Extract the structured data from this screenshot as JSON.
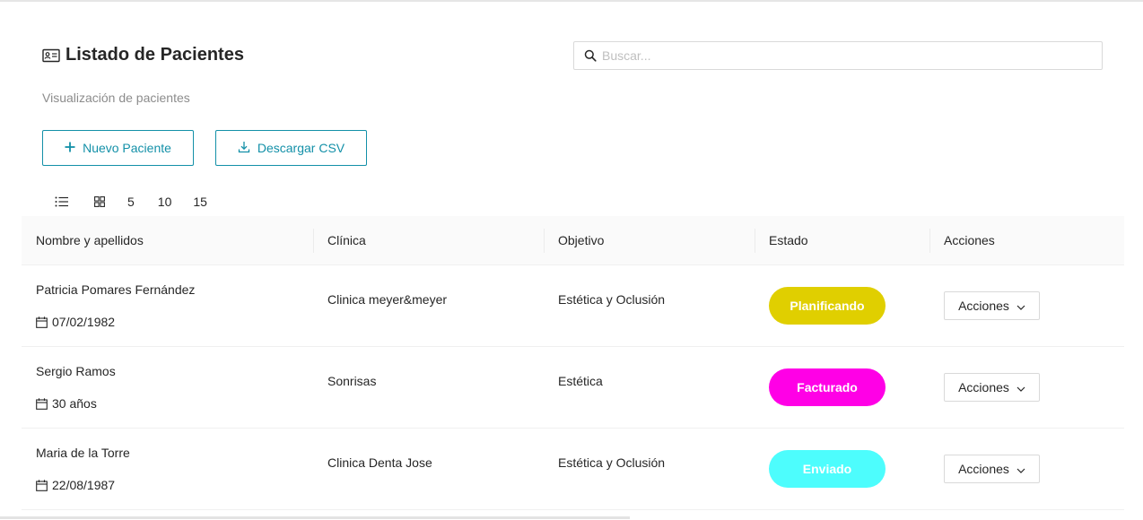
{
  "header": {
    "title": "Listado de Pacientes",
    "subtitle": "Visualización de pacientes",
    "title_icon": "id-card-icon"
  },
  "search": {
    "placeholder": "Buscar...",
    "value": "",
    "icon": "search-icon"
  },
  "toolbar": {
    "new_label": "Nuevo Paciente",
    "csv_label": "Descargar CSV"
  },
  "view_options": {
    "list_icon": "list-view-icon",
    "grid_icon": "grid-view-icon",
    "page_sizes": [
      "5",
      "10",
      "15"
    ]
  },
  "table": {
    "columns": [
      "Nombre y apellidos",
      "Clínica",
      "Objetivo",
      "Estado",
      "Acciones"
    ],
    "rows": [
      {
        "name": "Patricia Pomares Fernández",
        "date": "07/02/1982",
        "clinic": "Clinica meyer&meyer",
        "objective": "Estética y Oclusión",
        "status": "Planificando",
        "status_color": "#e0cf00",
        "action": "Acciones"
      },
      {
        "name": "Sergio Ramos",
        "date": "30 años",
        "clinic": "Sonrisas",
        "objective": "Estética",
        "status": "Facturado",
        "status_color": "#ff00e6",
        "action": "Acciones"
      },
      {
        "name": "Maria de la Torre",
        "date": "22/08/1987",
        "clinic": "Clinica Denta Jose",
        "objective": "Estética y Oclusión",
        "status": "Enviado",
        "status_color": "#4dfdfd",
        "action": "Acciones"
      }
    ]
  },
  "colors": {
    "accent": "#1390a8"
  }
}
